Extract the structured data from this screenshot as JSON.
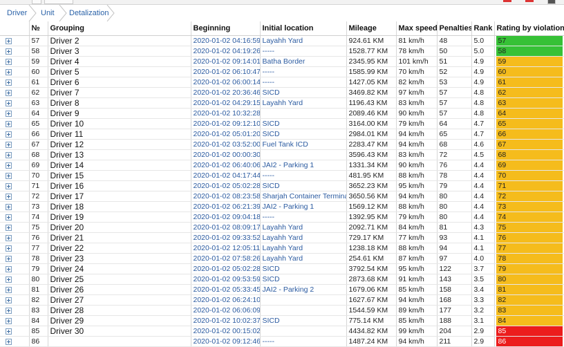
{
  "breadcrumbs": [
    "Driver",
    "Unit",
    "Detalization"
  ],
  "columns": [
    "№",
    "Grouping",
    "Beginning",
    "Initial location",
    "Mileage",
    "Max speed",
    "Penalties",
    "Rank",
    "Rating by violations"
  ],
  "colors": {
    "green": "#36c136",
    "orange": "#f5bc1c",
    "red": "#ec1c1c",
    "link": "#2a5aa0"
  },
  "rows": [
    {
      "n": "57",
      "name": "Driver 2",
      "begin": "2020-01-02 04:16:59",
      "loc": "Layahh Yard",
      "mileage": "924.61 KM",
      "speed": "81 km/h",
      "pen": "48",
      "rank": "5.0",
      "rating": "57",
      "color": "green"
    },
    {
      "n": "58",
      "name": "Driver 3",
      "begin": "2020-01-02 04:19:26",
      "loc": "-----",
      "mileage": "1528.77 KM",
      "speed": "78 km/h",
      "pen": "50",
      "rank": "5.0",
      "rating": "58",
      "color": "green"
    },
    {
      "n": "59",
      "name": "Driver 4",
      "begin": "2020-01-02 09:14:01",
      "loc": "Batha Border",
      "mileage": "2345.95 KM",
      "speed": "101 km/h",
      "pen": "51",
      "rank": "4.9",
      "rating": "59",
      "color": "orange"
    },
    {
      "n": "60",
      "name": "Driver 5",
      "begin": "2020-01-02 06:10:47",
      "loc": "-----",
      "mileage": "1585.99 KM",
      "speed": "70 km/h",
      "pen": "52",
      "rank": "4.9",
      "rating": "60",
      "color": "orange"
    },
    {
      "n": "61",
      "name": "Driver 6",
      "begin": "2020-01-02 06:00:14",
      "loc": "-----",
      "mileage": "1427.05 KM",
      "speed": "82 km/h",
      "pen": "53",
      "rank": "4.9",
      "rating": "61",
      "color": "orange"
    },
    {
      "n": "62",
      "name": "Driver 7",
      "begin": "2020-01-02 20:36:46",
      "loc": "SICD",
      "mileage": "3469.82 KM",
      "speed": "97 km/h",
      "pen": "57",
      "rank": "4.8",
      "rating": "62",
      "color": "orange"
    },
    {
      "n": "63",
      "name": "Driver 8",
      "begin": "2020-01-02 04:29:15",
      "loc": "Layahh Yard",
      "mileage": "1196.43 KM",
      "speed": "83 km/h",
      "pen": "57",
      "rank": "4.8",
      "rating": "63",
      "color": "orange"
    },
    {
      "n": "64",
      "name": "Driver 9",
      "begin": "2020-01-02 10:32:28",
      "loc": "",
      "mileage": "2089.46 KM",
      "speed": "90 km/h",
      "pen": "57",
      "rank": "4.8",
      "rating": "64",
      "color": "orange"
    },
    {
      "n": "65",
      "name": "Driver 10",
      "begin": "2020-01-02 09:12:10",
      "loc": "SICD",
      "mileage": "3164.00 KM",
      "speed": "79 km/h",
      "pen": "64",
      "rank": "4.7",
      "rating": "65",
      "color": "orange"
    },
    {
      "n": "66",
      "name": "Driver 11",
      "begin": "2020-01-02 05:01:20",
      "loc": "SICD",
      "mileage": "2984.01 KM",
      "speed": "94 km/h",
      "pen": "65",
      "rank": "4.7",
      "rating": "66",
      "color": "orange"
    },
    {
      "n": "67",
      "name": "Driver 12",
      "begin": "2020-01-02 03:52:00",
      "loc": "Fuel Tank ICD",
      "mileage": "2283.47 KM",
      "speed": "94 km/h",
      "pen": "68",
      "rank": "4.6",
      "rating": "67",
      "color": "orange"
    },
    {
      "n": "68",
      "name": "Driver 13",
      "begin": "2020-01-02 00:00:30",
      "loc": "",
      "mileage": "3596.43 KM",
      "speed": "83 km/h",
      "pen": "72",
      "rank": "4.5",
      "rating": "68",
      "color": "orange"
    },
    {
      "n": "69",
      "name": "Driver 14",
      "begin": "2020-01-02 06:40:06",
      "loc": "JAI2 - Parking 1",
      "mileage": "1331.34 KM",
      "speed": "90 km/h",
      "pen": "76",
      "rank": "4.4",
      "rating": "69",
      "color": "orange"
    },
    {
      "n": "70",
      "name": "Driver 15",
      "begin": "2020-01-02 04:17:44",
      "loc": "-----",
      "mileage": "481.95 KM",
      "speed": "88 km/h",
      "pen": "78",
      "rank": "4.4",
      "rating": "70",
      "color": "orange"
    },
    {
      "n": "71",
      "name": "Driver 16",
      "begin": "2020-01-02 05:02:28",
      "loc": "SICD",
      "mileage": "3652.23 KM",
      "speed": "95 km/h",
      "pen": "79",
      "rank": "4.4",
      "rating": "71",
      "color": "orange"
    },
    {
      "n": "72",
      "name": "Driver 17",
      "begin": "2020-01-02 08:23:58",
      "loc": "Sharjah Container Terminal",
      "mileage": "3650.56 KM",
      "speed": "94 km/h",
      "pen": "80",
      "rank": "4.4",
      "rating": "72",
      "color": "orange"
    },
    {
      "n": "73",
      "name": "Driver 18",
      "begin": "2020-01-02 06:21:39",
      "loc": "JAI2 - Parking 1",
      "mileage": "1569.12 KM",
      "speed": "88 km/h",
      "pen": "80",
      "rank": "4.4",
      "rating": "73",
      "color": "orange"
    },
    {
      "n": "74",
      "name": "Driver 19",
      "begin": "2020-01-02 09:04:18",
      "loc": "-----",
      "mileage": "1392.95 KM",
      "speed": "79 km/h",
      "pen": "80",
      "rank": "4.4",
      "rating": "74",
      "color": "orange"
    },
    {
      "n": "75",
      "name": "Driver 20",
      "begin": "2020-01-02 08:09:17",
      "loc": "Layahh Yard",
      "mileage": "2092.71 KM",
      "speed": "84 km/h",
      "pen": "81",
      "rank": "4.3",
      "rating": "75",
      "color": "orange"
    },
    {
      "n": "76",
      "name": "Driver 21",
      "begin": "2020-01-02 09:33:52",
      "loc": "Layahh Yard",
      "mileage": "729.17 KM",
      "speed": "77 km/h",
      "pen": "93",
      "rank": "4.1",
      "rating": "76",
      "color": "orange"
    },
    {
      "n": "77",
      "name": "Driver 22",
      "begin": "2020-01-02 12:05:11",
      "loc": "Layahh Yard",
      "mileage": "1238.18 KM",
      "speed": "88 km/h",
      "pen": "94",
      "rank": "4.1",
      "rating": "77",
      "color": "orange"
    },
    {
      "n": "78",
      "name": "Driver 23",
      "begin": "2020-01-02 07:58:26",
      "loc": "Layahh Yard",
      "mileage": "254.61 KM",
      "speed": "87 km/h",
      "pen": "97",
      "rank": "4.0",
      "rating": "78",
      "color": "orange"
    },
    {
      "n": "79",
      "name": "Driver 24",
      "begin": "2020-01-02 05:02:28",
      "loc": "SICD",
      "mileage": "3792.54 KM",
      "speed": "95 km/h",
      "pen": "122",
      "rank": "3.7",
      "rating": "79",
      "color": "orange"
    },
    {
      "n": "80",
      "name": "Driver 25",
      "begin": "2020-01-02 09:53:59",
      "loc": "SICD",
      "mileage": "2873.68 KM",
      "speed": "91 km/h",
      "pen": "143",
      "rank": "3.5",
      "rating": "80",
      "color": "orange"
    },
    {
      "n": "81",
      "name": "Driver 26",
      "begin": "2020-01-02 05:33:45",
      "loc": "JAI2 - Parking 2",
      "mileage": "1679.06 KM",
      "speed": "85 km/h",
      "pen": "158",
      "rank": "3.4",
      "rating": "81",
      "color": "orange"
    },
    {
      "n": "82",
      "name": "Driver 27",
      "begin": "2020-01-02 06:24:10",
      "loc": "",
      "mileage": "1627.67 KM",
      "speed": "94 km/h",
      "pen": "168",
      "rank": "3.3",
      "rating": "82",
      "color": "orange"
    },
    {
      "n": "83",
      "name": "Driver 28",
      "begin": "2020-01-02 06:06:09",
      "loc": "",
      "mileage": "1544.59 KM",
      "speed": "89 km/h",
      "pen": "177",
      "rank": "3.2",
      "rating": "83",
      "color": "orange"
    },
    {
      "n": "84",
      "name": "Driver 29",
      "begin": "2020-01-02 10:02:37",
      "loc": "SICD",
      "mileage": "775.14 KM",
      "speed": "85 km/h",
      "pen": "188",
      "rank": "3.1",
      "rating": "84",
      "color": "orange"
    },
    {
      "n": "85",
      "name": "Driver 30",
      "begin": "2020-01-02 00:15:02",
      "loc": "",
      "mileage": "4434.82 KM",
      "speed": "99 km/h",
      "pen": "204",
      "rank": "2.9",
      "rating": "85",
      "color": "red"
    },
    {
      "n": "86",
      "name": "",
      "begin": "2020-01-02 09:12:46",
      "loc": "-----",
      "mileage": "1487.24 KM",
      "speed": "94 km/h",
      "pen": "211",
      "rank": "2.9",
      "rating": "86",
      "color": "red"
    }
  ]
}
